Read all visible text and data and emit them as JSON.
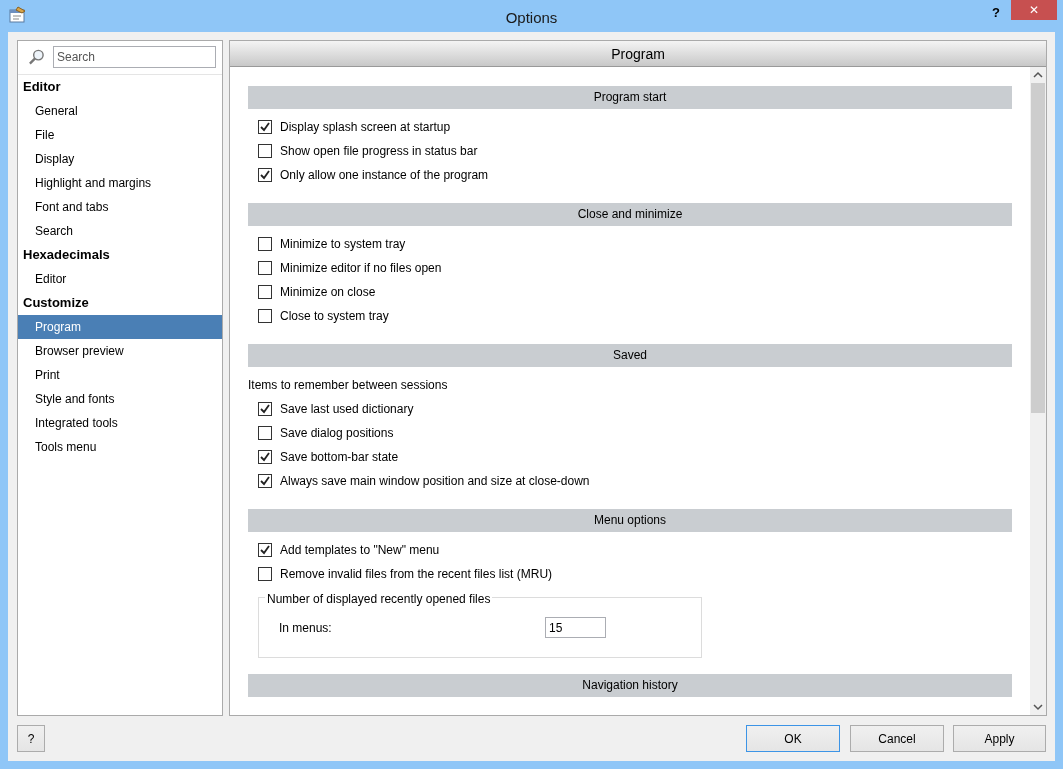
{
  "window": {
    "title": "Options",
    "help_glyph": "?",
    "close_glyph": "✕"
  },
  "search": {
    "placeholder": "Search"
  },
  "sidebar": {
    "items": [
      {
        "kind": "heading",
        "label": "Editor",
        "selected": false
      },
      {
        "kind": "item",
        "label": "General",
        "selected": false
      },
      {
        "kind": "item",
        "label": "File",
        "selected": false
      },
      {
        "kind": "item",
        "label": "Display",
        "selected": false
      },
      {
        "kind": "item",
        "label": "Highlight and margins",
        "selected": false
      },
      {
        "kind": "item",
        "label": "Font and tabs",
        "selected": false
      },
      {
        "kind": "item",
        "label": "Search",
        "selected": false
      },
      {
        "kind": "heading",
        "label": "Hexadecimals",
        "selected": false
      },
      {
        "kind": "item",
        "label": "Editor",
        "selected": false
      },
      {
        "kind": "heading",
        "label": "Customize",
        "selected": false
      },
      {
        "kind": "item",
        "label": "Program",
        "selected": true
      },
      {
        "kind": "item",
        "label": "Browser preview",
        "selected": false
      },
      {
        "kind": "item",
        "label": "Print",
        "selected": false
      },
      {
        "kind": "item",
        "label": "Style and fonts",
        "selected": false
      },
      {
        "kind": "item",
        "label": "Integrated tools",
        "selected": false
      },
      {
        "kind": "item",
        "label": "Tools menu",
        "selected": false
      }
    ]
  },
  "page": {
    "title": "Program",
    "sections": [
      {
        "title": "Program start",
        "items": [
          {
            "label": "Display splash screen at startup",
            "checked": true
          },
          {
            "label": "Show open file progress in status bar",
            "checked": false
          },
          {
            "label": "Only allow one instance of the program",
            "checked": true
          }
        ]
      },
      {
        "title": "Close and minimize",
        "items": [
          {
            "label": "Minimize to system tray",
            "checked": false
          },
          {
            "label": "Minimize editor if no files open",
            "checked": false
          },
          {
            "label": "Minimize on close",
            "checked": false
          },
          {
            "label": "Close to system tray",
            "checked": false
          }
        ]
      },
      {
        "title": "Saved",
        "note": "Items to remember between sessions",
        "items": [
          {
            "label": "Save last used dictionary",
            "checked": true
          },
          {
            "label": "Save dialog positions",
            "checked": false
          },
          {
            "label": "Save bottom-bar state",
            "checked": true
          },
          {
            "label": "Always save main window position and size at close-down",
            "checked": true
          }
        ]
      },
      {
        "title": "Menu options",
        "items": [
          {
            "label": "Add templates to \"New\" menu",
            "checked": true
          },
          {
            "label": "Remove invalid files from the recent files list (MRU)",
            "checked": false
          }
        ],
        "group": {
          "legend": "Number of displayed recently opened files",
          "field_label": "In menus:",
          "value": "15"
        }
      },
      {
        "title": "Navigation history"
      }
    ]
  },
  "buttons": {
    "help": "?",
    "ok": "OK",
    "cancel": "Cancel",
    "apply": "Apply"
  }
}
